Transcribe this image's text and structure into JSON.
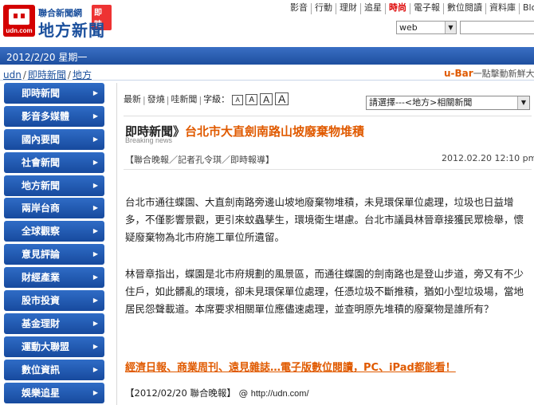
{
  "header": {
    "logo_main": "地方新聞",
    "logo_sub": "聯合新聞網",
    "logo_tag": "即時",
    "logo_url": "udn.com",
    "nav": [
      "影音",
      "行動",
      "理財",
      "追星",
      "時尚",
      "電子報",
      "數位閱讀",
      "資料庫",
      "Blog"
    ],
    "nav_hot_index": 4,
    "search_select": "web",
    "search_value": ""
  },
  "datebar": {
    "date": "2012/2/20 星期一"
  },
  "breadcrumb": {
    "items": [
      "udn",
      "即時新聞",
      "地方"
    ],
    "separator": "/"
  },
  "ubar": {
    "brand": "u-Bar",
    "text": "一點擊動新鮮大"
  },
  "sidebar": {
    "items": [
      "即時新聞",
      "影音多媒體",
      "國內要聞",
      "社會新聞",
      "地方新聞",
      "兩岸台商",
      "全球觀察",
      "意見評論",
      "財經產業",
      "股市投資",
      "基金理財",
      "運動大聯盟",
      "數位資訊",
      "娛樂追星"
    ]
  },
  "toolbar": {
    "links": [
      "最新",
      "發燒",
      "哇新聞"
    ],
    "font_label": "字級：",
    "font_sizes": [
      "A",
      "A",
      "A",
      "A"
    ],
    "related_select": "請選擇---<地方>相關新聞"
  },
  "article": {
    "section": "即時新聞",
    "chevron": "》",
    "title": "台北市大直劍南路山坡廢棄物堆積",
    "breaking": "Breaking news",
    "byline": "【聯合晚報／記者孔令琪／即時報導】",
    "timestamp": "2012.02.20  12:10 pm",
    "paragraphs": [
      "台北市通往蝶園、大直劍南路旁邊山坡地廢棄物堆積，未見環保單位處理，垃圾也日益增多，不僅影響景觀，更引來蚊蟲孳生，環境衛生堪慮。台北市議員林晉章接獲民眾檢舉，懷疑廢棄物為北市府施工單位所遺留。",
      "林晉章指出，蝶園是北市府規劃的風景區，而通往蝶園的劍南路也是登山步道，旁又有不少住戶，如此髒亂的環境，卻未見環保單位處理，任憑垃圾不斷推積，猶如小型垃圾場，當地居民怨聲載道。本席要求相關單位應儘速處理，並查明原先堆積的廢棄物是誰所有？"
    ],
    "promo": "經濟日報、商業周刊、遠見雜誌…電子版數位閱讀，PC、iPad都能看！",
    "source": "【2012/02/20 聯合晚報】",
    "source_at": "@",
    "source_url": "http://udn.com/"
  },
  "colors": {
    "brand_blue": "#1a4f9c",
    "accent_orange": "#e05a00",
    "logo_red": "#d40000"
  }
}
